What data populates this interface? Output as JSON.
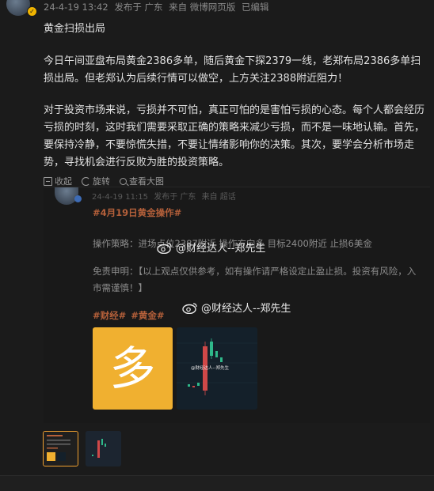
{
  "post": {
    "date": "24-4-19 13:42",
    "published_in": "发布于 广东",
    "source": "来自 微博网页版",
    "edited": "已编辑",
    "title": "黄金扫损出局",
    "para1": "今日午间亚盘布局黄金2386多单，随后黄金下探2379一线，老郑布局2386多单扫损出局。但老郑认为后续行情可以做空，上方关注2388附近阻力！",
    "para2": "对于投资市场来说，亏损并不可怕，真正可怕的是害怕亏损的心态。每个人都会经历亏损的时刻，这时我们需要采取正确的策略来减少亏损，而不是一味地认输。首先，要保持冷静，不要惊慌失措，不要让情绪影响你的决策。其次，要学会分析市场走势，寻找机会进行反败为胜的投资策略。"
  },
  "actions": {
    "collapse": "收起",
    "rotate": "旋转",
    "view_large": "查看大图"
  },
  "preview": {
    "meta_date": "24-4-19 11:15",
    "meta_published": "发布于 广东",
    "meta_source": "来自 超话",
    "tag1": "#4月19日黄金操作#",
    "strategy": "操作策略：进场点位2387附近 操作方向多 目标2400附近 止损6美金",
    "disclaimer1": "免责申明：【以上观点仅供参考，如有操作请严格设定止盈止损。投资有风险，入",
    "disclaimer2": "市需谨慎！】",
    "tag_finance": "#财经#",
    "tag_gold": "#黄金#",
    "watermark": "@财经达人--郑先生",
    "card_char": "多",
    "chart_watermark": "@财经达人--郑先生"
  },
  "colors": {
    "tag": "#b5603a",
    "accent_yellow": "#f0b030",
    "thumb_border": "#f0a030"
  }
}
